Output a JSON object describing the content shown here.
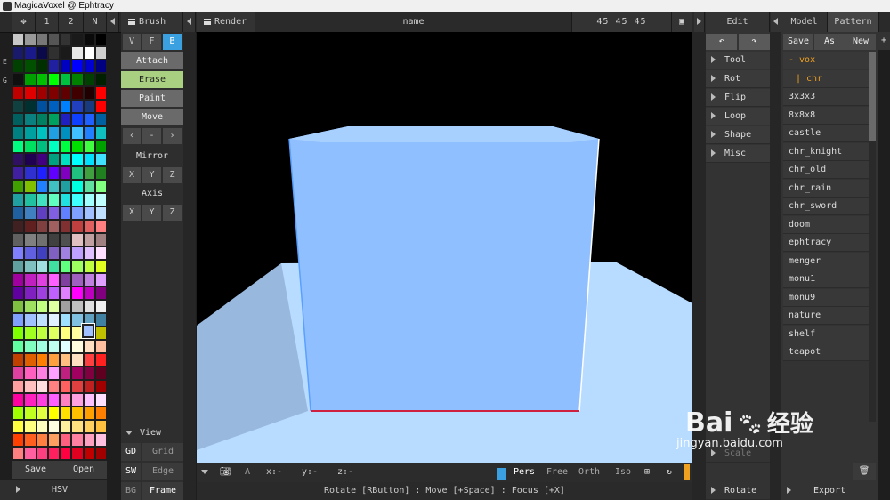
{
  "window": {
    "title": "MagicaVoxel @ Ephtracy"
  },
  "topbar": {
    "palette_tabs": [
      "1",
      "2",
      "N"
    ],
    "brush_label": "Brush",
    "render_label": "Render",
    "name_label": "name",
    "size_label": "45 45 45",
    "edit_label": "Edit",
    "model_tab": "Model",
    "pattern_tab": "Pattern"
  },
  "left_side_letters": [
    "E",
    "G"
  ],
  "palette": {
    "colors": [
      "#c8c8c8",
      "#999999",
      "#777777",
      "#555555",
      "#333333",
      "#1a1a1a",
      "#0a0a0a",
      "#000000",
      "#1a1a6a",
      "#1a1a8a",
      "#0a0a4a",
      "#303030",
      "#1a1a1a",
      "#e8e8e8",
      "#ffffff",
      "#d0d0d0",
      "#004000",
      "#005000",
      "#003000",
      "#2020a0",
      "#0000c0",
      "#0000ff",
      "#0000d0",
      "#000080",
      "#101010",
      "#00a000",
      "#00c000",
      "#00ff00",
      "#00c040",
      "#008000",
      "#004000",
      "#002000",
      "#c00000",
      "#e00000",
      "#a00000",
      "#800000",
      "#600000",
      "#400000",
      "#200000",
      "#ff0000",
      "#104040",
      "#003030",
      "#0050a0",
      "#0060c0",
      "#0080ff",
      "#2040c0",
      "#1a3a80",
      "#ff0000",
      "#006060",
      "#0a8080",
      "#008060",
      "#00a060",
      "#2020c0",
      "#1040ff",
      "#2060ff",
      "#0060a0",
      "#008080",
      "#00a0a0",
      "#00c0c0",
      "#20a0e0",
      "#0090c0",
      "#40c0ff",
      "#2080ff",
      "#10c0c0",
      "#00ff80",
      "#00e060",
      "#00c080",
      "#00ffc0",
      "#00ff40",
      "#00e000",
      "#40ff40",
      "#00a000",
      "#301060",
      "#200050",
      "#400080",
      "#00a080",
      "#00e0c0",
      "#00ffff",
      "#00e0ff",
      "#40e0ff",
      "#4020a0",
      "#3030d0",
      "#2020ff",
      "#6000ff",
      "#8000c0",
      "#20c080",
      "#40a040",
      "#208020",
      "#40a000",
      "#80c000",
      "#2080ff",
      "#40c0c0",
      "#20a0a0",
      "#00ffe0",
      "#60e0a0",
      "#80ff80",
      "#20a0a0",
      "#20c0a0",
      "#40e0c0",
      "#60ffc0",
      "#20e0e0",
      "#40ffff",
      "#a0ffff",
      "#c0ffff",
      "#2060a0",
      "#4080c0",
      "#6040c0",
      "#8060e0",
      "#6080ff",
      "#80a0ff",
      "#a0c0ff",
      "#c0e0ff",
      "#402020",
      "#602020",
      "#804040",
      "#a06060",
      "#803030",
      "#c04040",
      "#e06060",
      "#ff8080",
      "#606060",
      "#808080",
      "#707070",
      "#404040",
      "#505050",
      "#e0c0c0",
      "#c0a0a0",
      "#a08080",
      "#8080ff",
      "#6060e0",
      "#4040c0",
      "#8060c0",
      "#a080e0",
      "#c0a0ff",
      "#e0c0ff",
      "#ffe0ff",
      "#60a0a0",
      "#80c0c0",
      "#a0e0e0",
      "#40e0a0",
      "#60ff80",
      "#a0ff60",
      "#c0ff40",
      "#e0ff20",
      "#a000a0",
      "#c020c0",
      "#e040e0",
      "#ff60ff",
      "#8040a0",
      "#a060c0",
      "#c080e0",
      "#e0a0ff",
      "#6000a0",
      "#8020c0",
      "#a040e0",
      "#c060ff",
      "#e080ff",
      "#ff00ff",
      "#c000c0",
      "#800080",
      "#80c040",
      "#a0e060",
      "#c0ff80",
      "#e0ffa0",
      "#a0a0a0",
      "#c0c0c0",
      "#e0e0e0",
      "#f0f0f0",
      "#80a0ff",
      "#a0c0ff",
      "#c0e0ff",
      "#e0f0ff",
      "#a0e0ff",
      "#80c0e0",
      "#60a0c0",
      "#4080a0",
      "#80ff00",
      "#a0ff20",
      "#c0ff40",
      "#e0ff60",
      "#ffff80",
      "#ffffa0",
      "#a0c0ff",
      "#c0c000",
      "#60ffa0",
      "#80ffc0",
      "#a0ffe0",
      "#c0fff0",
      "#e0ffff",
      "#ffffe0",
      "#ffe0c0",
      "#ffc0a0",
      "#c04000",
      "#e06000",
      "#ff8000",
      "#ffa040",
      "#ffc080",
      "#ffe0c0",
      "#ff4040",
      "#ff2020",
      "#e040a0",
      "#ff60c0",
      "#ff80e0",
      "#ffa0ff",
      "#c02080",
      "#a00060",
      "#800040",
      "#600020",
      "#ffa0a0",
      "#ffc0c0",
      "#ffe0e0",
      "#ff8080",
      "#ff6060",
      "#e04040",
      "#c02020",
      "#a00000",
      "#ff00a0",
      "#ff20c0",
      "#ff40e0",
      "#ff60ff",
      "#ff80c0",
      "#ffa0e0",
      "#ffc0ff",
      "#ffe0ff",
      "#a0ff00",
      "#c0ff20",
      "#e0ff40",
      "#ffff00",
      "#ffe000",
      "#ffc000",
      "#ffa000",
      "#ff8000",
      "#ffff40",
      "#ffff80",
      "#ffffc0",
      "#ffffe0",
      "#fff0a0",
      "#ffe080",
      "#ffd060",
      "#ffc040",
      "#ff4000",
      "#ff6020",
      "#ff8040",
      "#ffa060",
      "#ff6080",
      "#ff80a0",
      "#ffa0c0",
      "#ffc0e0",
      "#ff8080",
      "#ff60a0",
      "#ff4080",
      "#ff2060",
      "#ff0040",
      "#e00020",
      "#c00000",
      "#a00000"
    ],
    "save_label": "Save",
    "open_label": "Open",
    "mode_label": "HSV"
  },
  "brush": {
    "modes": [
      "V",
      "F",
      "B"
    ],
    "actions": [
      "Attach",
      "Erase",
      "Paint",
      "Move"
    ],
    "move_arrows": [
      "‹",
      "-",
      "›"
    ],
    "mirror_label": "Mirror",
    "mirror_axes": [
      "X",
      "Y",
      "Z"
    ],
    "axis_label": "Axis",
    "axis_axes": [
      "X",
      "Y",
      "Z"
    ],
    "view_label": "View",
    "view_rows": [
      {
        "key": "GD",
        "val": "Grid"
      },
      {
        "key": "SW",
        "val": "Edge"
      },
      {
        "key": "BG",
        "val": "Frame"
      }
    ]
  },
  "viewport": {
    "bottom": {
      "axis_a": "A",
      "x": "x:-",
      "y": "y:-",
      "z": "z:-",
      "modes": [
        "Pers",
        "Free",
        "Orth",
        "Iso"
      ]
    },
    "status": "Rotate [RButton] : Move [+Space] : Focus [+X]"
  },
  "edit": {
    "menu": [
      "Tool",
      "Rot",
      "Flip",
      "Loop",
      "Shape",
      "Misc"
    ],
    "bottom_items": [
      "Scale",
      "Rotate"
    ]
  },
  "files": {
    "actions": [
      "Save",
      "As",
      "New"
    ],
    "list": [
      "- vox",
      "| chr",
      "3x3x3",
      "8x8x8",
      "castle",
      "chr_knight",
      "chr_old",
      "chr_rain",
      "chr_sword",
      "doom",
      "ephtracy",
      "menger",
      "monu1",
      "monu9",
      "nature",
      "shelf",
      "teapot"
    ],
    "export_label": "Export"
  },
  "watermark": {
    "brand": "Bai",
    "cn": "经验",
    "url": "jingyan.baidu.com"
  },
  "colors": {
    "accent": "#3aa0e0",
    "erase": "#a8d080",
    "folder": "#f0a020",
    "cube": "#8fbfff",
    "floor": "#b8dcff"
  }
}
